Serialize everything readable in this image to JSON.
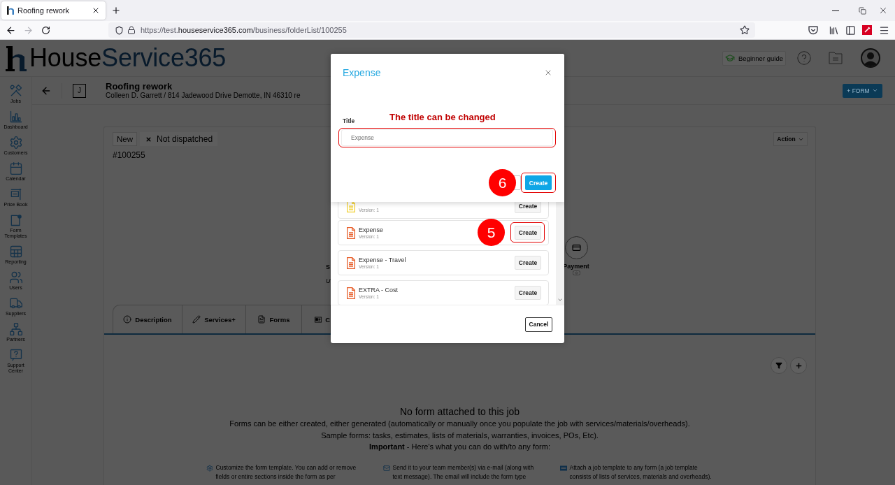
{
  "browser": {
    "tab": {
      "title": "Roofing rework"
    },
    "url": {
      "scheme": "https://test.",
      "domain": "houseservice365.com",
      "path": "/business/folderList/100255"
    },
    "forward_disabled": true
  },
  "header": {
    "logo": {
      "first": "House",
      "second": "Service365"
    },
    "guide_button": "Beginner guide"
  },
  "sidebar": {
    "items": [
      {
        "kind": "jobs",
        "label": "Jobs"
      },
      {
        "kind": "dashboard",
        "label": "Dashboard"
      },
      {
        "kind": "customers",
        "label": "Customers"
      },
      {
        "kind": "calendar",
        "label": "Calendar"
      },
      {
        "kind": "price_book",
        "label": "Price Book"
      },
      {
        "kind": "form_templates",
        "label": "Form Templates"
      },
      {
        "kind": "reporting",
        "label": "Reporting"
      },
      {
        "kind": "users",
        "label": "Users"
      },
      {
        "kind": "suppliers",
        "label": "Suppliers"
      },
      {
        "kind": "partners",
        "label": "Partners"
      },
      {
        "kind": "support",
        "label": "Support Center"
      }
    ]
  },
  "job": {
    "badge": "J",
    "title": "Roofing rework",
    "subtitle": "Colleen D. Garrett / 814 Jadewood Drive Demotte, IN 46310 re",
    "form_button": "+ FORM"
  },
  "card": {
    "status": "New",
    "dispatch": "Not dispatched",
    "number": "#100255",
    "action_button": "Action",
    "steps": [
      {
        "kind": "hidden",
        "label": "S",
        "note": "U"
      },
      {
        "kind": "payment",
        "label": "Payment"
      }
    ],
    "tabs": [
      {
        "kind": "description",
        "label": "Description"
      },
      {
        "kind": "services",
        "label": "Services+"
      },
      {
        "kind": "forms",
        "label": "Forms"
      },
      {
        "kind": "contact",
        "label": "C"
      }
    ]
  },
  "forms_panel": {
    "empty_title": "No form attached to this job",
    "lines": [
      "Forms can be either created, either generated (automatically or manually once you populate the job with services/materials/overheads).",
      "Sample forms: tasks, estimates, lists of materials, warranties, invoices, POs, Etc).",
      "**Important** - Here's what you can do with/to any form:"
    ],
    "features": [
      {
        "kind": "customize",
        "text": "Customize the form template. You can add or remove fields or entire sections inside the form as per"
      },
      {
        "kind": "send",
        "text": "Send it to your team member(s) via e-mail (along with text message). The email will include the form type"
      },
      {
        "kind": "attach",
        "text": "Attach a job template to any form (a job template consists of lists of services, materials and overheads)."
      }
    ]
  },
  "form_picker": {
    "items": [
      {
        "color": "#f2d23a",
        "version": "Version: 1",
        "button": "Create",
        "highlighted": false
      },
      {
        "color": "#e8602c",
        "title": "Expense",
        "version": "Version: 1",
        "button": "Create",
        "highlighted": true,
        "marker": "5"
      },
      {
        "color": "#e8602c",
        "title": "Expense - Travel",
        "version": "Version: 1",
        "button": "Create",
        "highlighted": false
      },
      {
        "color": "#e8602c",
        "title": "EXTRA - Cost",
        "version": "Version: 1",
        "button": "Create",
        "highlighted": false
      }
    ],
    "cancel": "Cancel"
  },
  "title_dialog": {
    "heading": "Expense",
    "note": "The title can be changed",
    "field_label": "Title",
    "value": "Expense",
    "create_button": "Create",
    "field_highlighted": true,
    "create_highlighted": true,
    "marker": "6"
  }
}
